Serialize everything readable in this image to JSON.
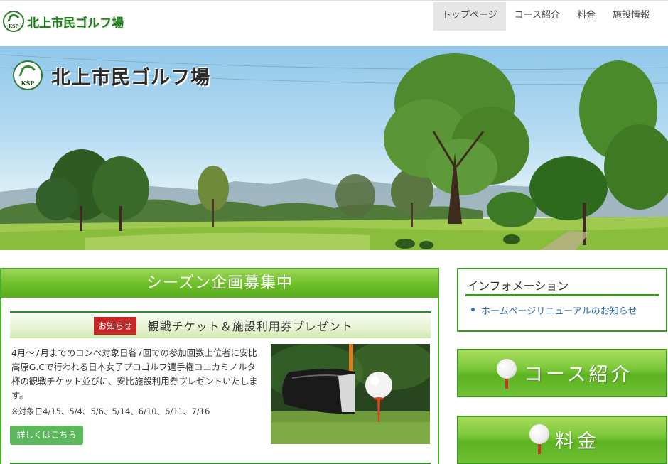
{
  "header": {
    "logo_text": "北上市民ゴルフ場",
    "logo_badge": "KSP"
  },
  "nav": {
    "items": [
      {
        "label": "トップページ",
        "active": true
      },
      {
        "label": "コース紹介",
        "active": false
      },
      {
        "label": "料金",
        "active": false
      },
      {
        "label": "施設情報",
        "active": false
      }
    ]
  },
  "hero": {
    "title": "北上市民ゴルフ場",
    "badge": "KSP"
  },
  "main": {
    "section_title": "シーズン企画募集中",
    "news": {
      "badge": "お知らせ",
      "title": "観戦チケット＆施設利用券プレゼント",
      "body": "4月～7月までのコンペ対象日各7回での参加回数上位者に安比高原G.Cで行われる日本女子プロゴルフ選手権コニカミノルタ杯の観戦チケット並びに、安比施設利用券プレゼントいたします。",
      "note": "※対象日4/15、5/4、5/6、5/14、6/10、6/11、7/16",
      "more_button": "詳しくはこちら"
    }
  },
  "sidebar": {
    "info_title": "インフォメーション",
    "info_link": "ホームページリニューアルのお知らせ",
    "buttons": [
      {
        "label": "コース紹介"
      },
      {
        "label": "料金"
      }
    ]
  },
  "colors": {
    "accent_green": "#4caf2a",
    "badge_red": "#c62828",
    "link_blue": "#2a6fb8"
  }
}
